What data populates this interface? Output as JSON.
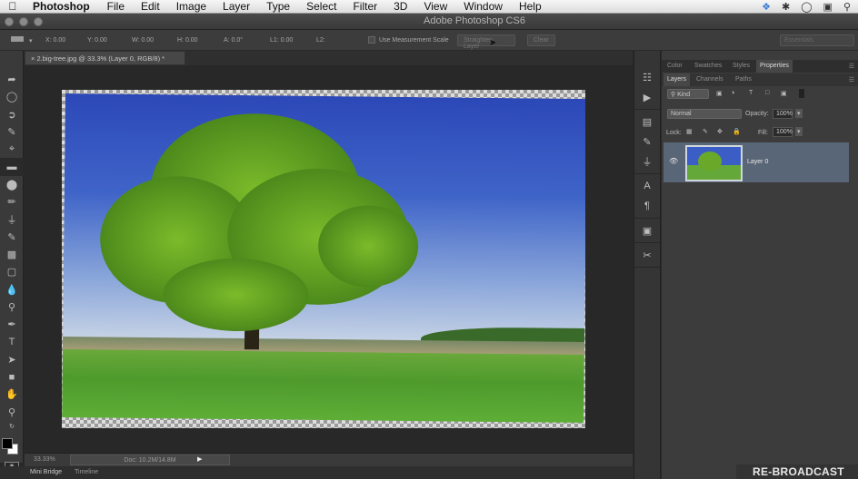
{
  "menubar": {
    "app": "Photoshop",
    "items": [
      "File",
      "Edit",
      "Image",
      "Layer",
      "Type",
      "Select",
      "Filter",
      "3D",
      "View",
      "Window",
      "Help"
    ],
    "status_icons": [
      "dropbox-icon",
      "bluetooth-icon",
      "power-icon",
      "display-icon",
      "spotlight-icon"
    ]
  },
  "window": {
    "title": "Adobe Photoshop CS6"
  },
  "options_bar": {
    "x": "X: 0.00",
    "y": "Y: 0.00",
    "w": "W: 0.00",
    "h": "H: 0.00",
    "angle": "A: 0.0°",
    "l1": "L1: 0.00",
    "l2": "L2:",
    "use_measurement_scale": "Use Measurement Scale",
    "straighten_layer": "Straighten Layer",
    "clear": "Clear",
    "workspace": "Essentials"
  },
  "document": {
    "tab_title": "2.big-tree.jpg @ 33.3% (Layer 0, RGB/8) *",
    "zoom": "33.33%",
    "doc_info": "Doc: 10.2M/14.8M"
  },
  "bottom_tabs": [
    "Mini Bridge",
    "Timeline"
  ],
  "panels": {
    "top_tabs": [
      "Color",
      "Swatches",
      "Styles",
      "Properties"
    ],
    "active_top_tab": "Properties",
    "layer_tabs": [
      "Layers",
      "Channels",
      "Paths"
    ],
    "kind_filter": "Kind",
    "blend_mode": "Normal",
    "opacity_label": "Opacity:",
    "opacity_value": "100%",
    "lock_label": "Lock:",
    "fill_label": "Fill:",
    "fill_value": "100%",
    "layers": [
      {
        "name": "Layer 0",
        "visible": true
      }
    ]
  },
  "watermark": "RE-BROADCAST"
}
